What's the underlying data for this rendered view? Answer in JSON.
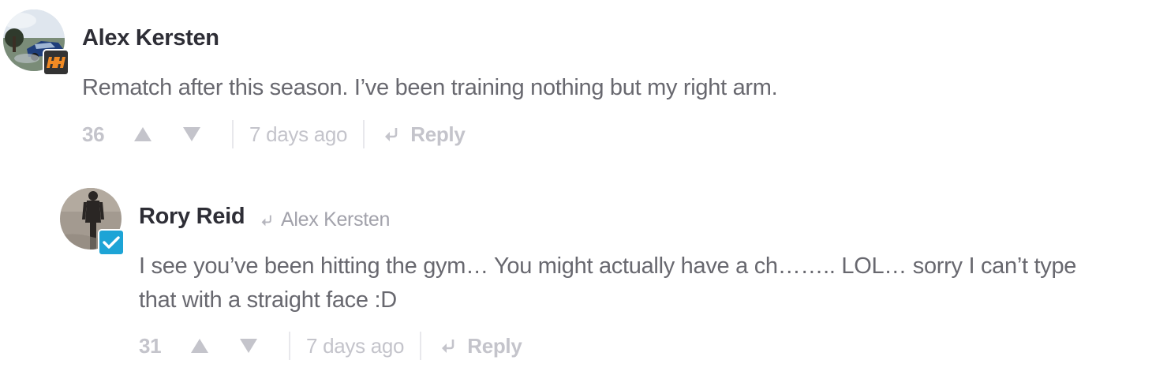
{
  "comments": [
    {
      "author": "Alex Kersten",
      "text": "Rematch after this season. I’ve been training nothing but my right arm.",
      "score": "36",
      "timestamp": "7 days ago",
      "reply_label": "Reply",
      "badge_icon": "brand-logo-badge"
    },
    {
      "author": "Rory Reid",
      "reply_to": "Alex Kersten",
      "text": "I see you’ve been hitting the gym… You might actually have a ch…….. LOL… sorry I can’t type that with a straight face :D",
      "score": "31",
      "timestamp": "7 days ago",
      "reply_label": "Reply",
      "badge_icon": "verified-check-badge"
    }
  ],
  "colors": {
    "author": "#2e2e36",
    "body_text": "#68686f",
    "meta": "#c4c4cb",
    "verified_badge": "#1da4d6",
    "brand_badge_mark": "#f08a24"
  }
}
